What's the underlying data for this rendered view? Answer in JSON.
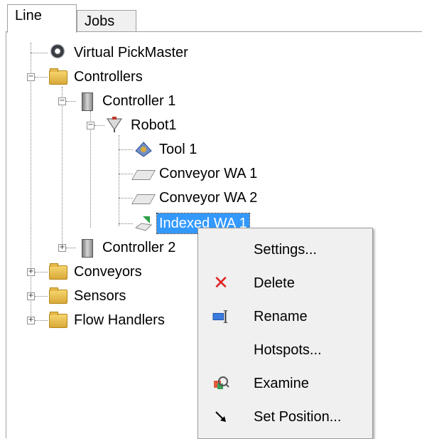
{
  "tabs": [
    {
      "label": "Line",
      "active": true
    },
    {
      "label": "Jobs",
      "active": false
    }
  ],
  "tree": {
    "root_item": "Virtual PickMaster",
    "controllers": "Controllers",
    "controller1": "Controller 1",
    "robot1": "Robot1",
    "tool1": "Tool 1",
    "conveyor_wa1": "Conveyor WA 1",
    "conveyor_wa2": "Conveyor WA 2",
    "indexed_wa1": "Indexed WA 1",
    "controller2": "Controller 2",
    "conveyors": "Conveyors",
    "sensors": "Sensors",
    "flow_handlers": "Flow Handlers"
  },
  "context_menu": {
    "items": [
      {
        "label": "Settings...",
        "icon": "none"
      },
      {
        "label": "Delete",
        "icon": "delete-x-icon"
      },
      {
        "label": "Rename",
        "icon": "rename-icon"
      },
      {
        "label": "Hotspots...",
        "icon": "none"
      },
      {
        "label": "Examine",
        "icon": "examine-icon"
      },
      {
        "label": "Set Position...",
        "icon": "arrow-icon"
      }
    ]
  },
  "colors": {
    "selection": "#3399ff",
    "delete_icon": "#e02020",
    "menu_background": "#f0f0f0"
  }
}
